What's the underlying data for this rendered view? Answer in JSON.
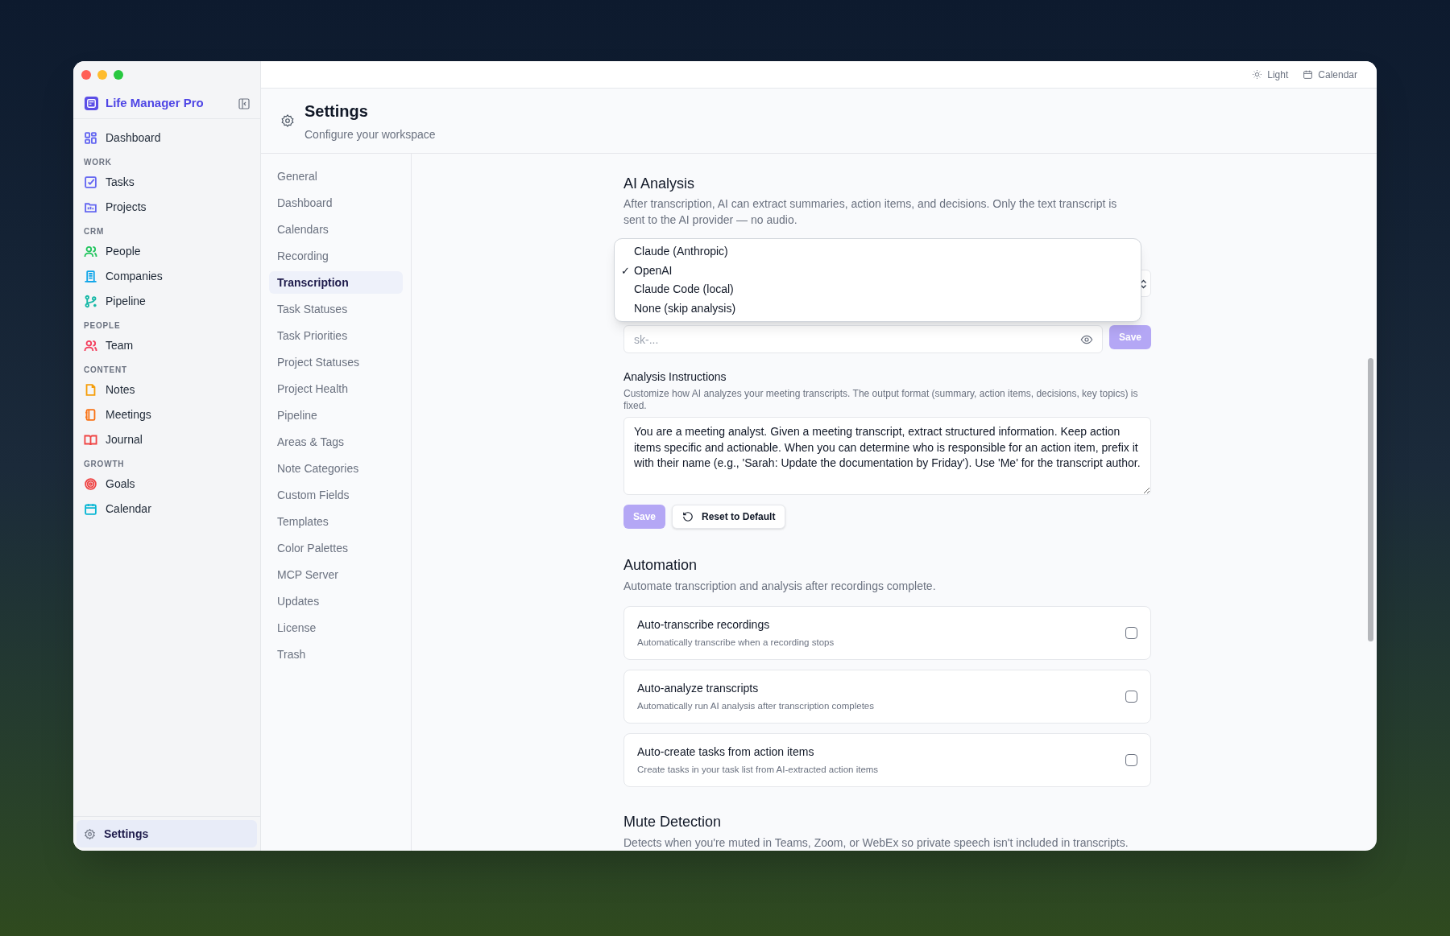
{
  "window": {
    "app_name": "Life Manager Pro"
  },
  "sidebar": {
    "sections": [
      {
        "items": [
          {
            "label": "Dashboard",
            "color": "#6366f1",
            "selected": false
          }
        ]
      },
      {
        "heading": "WORK",
        "items": [
          {
            "label": "Tasks",
            "color": "#6366f1",
            "selected": false
          },
          {
            "label": "Projects",
            "color": "#6366f1",
            "selected": false
          }
        ]
      },
      {
        "heading": "CRM",
        "items": [
          {
            "label": "People",
            "color": "#22c55e",
            "selected": false
          },
          {
            "label": "Companies",
            "color": "#0ea5e9",
            "selected": false
          },
          {
            "label": "Pipeline",
            "color": "#14b8a6",
            "selected": false
          }
        ]
      },
      {
        "heading": "PEOPLE",
        "items": [
          {
            "label": "Team",
            "color": "#f43f5e",
            "selected": false
          }
        ]
      },
      {
        "heading": "CONTENT",
        "items": [
          {
            "label": "Notes",
            "color": "#f59e0b",
            "selected": false
          },
          {
            "label": "Meetings",
            "color": "#f97316",
            "selected": false
          },
          {
            "label": "Journal",
            "color": "#ef4444",
            "selected": false
          }
        ]
      },
      {
        "heading": "GROWTH",
        "items": [
          {
            "label": "Goals",
            "color": "#ef4444",
            "selected": false
          },
          {
            "label": "Calendar",
            "color": "#06b6d4",
            "selected": false
          }
        ]
      }
    ],
    "footer_item": {
      "label": "Settings",
      "selected": true
    }
  },
  "top_bar": {
    "actions": [
      "Light",
      "Calendar"
    ]
  },
  "header": {
    "title": "Settings",
    "subtitle": "Configure your workspace"
  },
  "settings_nav": [
    {
      "label": "General",
      "selected": false
    },
    {
      "label": "Dashboard",
      "selected": false
    },
    {
      "label": "Calendars",
      "selected": false
    },
    {
      "label": "Recording",
      "selected": false
    },
    {
      "label": "Transcription",
      "selected": true
    },
    {
      "label": "Task Statuses",
      "selected": false
    },
    {
      "label": "Task Priorities",
      "selected": false
    },
    {
      "label": "Project Statuses",
      "selected": false
    },
    {
      "label": "Project Health",
      "selected": false
    },
    {
      "label": "Pipeline",
      "selected": false
    },
    {
      "label": "Areas & Tags",
      "selected": false
    },
    {
      "label": "Note Categories",
      "selected": false
    },
    {
      "label": "Custom Fields",
      "selected": false
    },
    {
      "label": "Templates",
      "selected": false
    },
    {
      "label": "Color Palettes",
      "selected": false
    },
    {
      "label": "MCP Server",
      "selected": false
    },
    {
      "label": "Updates",
      "selected": false
    },
    {
      "label": "License",
      "selected": false
    },
    {
      "label": "Trash",
      "selected": false
    }
  ],
  "ai_analysis": {
    "title": "AI Analysis",
    "description": "After transcription, AI can extract summaries, action items, and decisions. Only the text transcript is sent to the AI provider — no audio.",
    "provider_dropdown": {
      "open": true,
      "options": [
        {
          "label": "Claude (Anthropic)",
          "selected": false
        },
        {
          "label": "OpenAI",
          "selected": true
        },
        {
          "label": "Claude Code (local)",
          "selected": false
        },
        {
          "label": "None (skip analysis)",
          "selected": false
        }
      ],
      "check_mark": "✓"
    },
    "api_key": {
      "placeholder": "sk-...",
      "save_button": {
        "label": "Save",
        "disabled": true
      }
    },
    "instructions": {
      "label": "Analysis Instructions",
      "hint": "Customize how AI analyzes your meeting transcripts. The output format (summary, action items, decisions, key topics) is fixed.",
      "value": "You are a meeting analyst. Given a meeting transcript, extract structured information. Keep action items specific and actionable. When you can determine who is responsible for an action item, prefix it with their name (e.g., 'Sarah: Update the documentation by Friday'). Use 'Me' for the transcript author.",
      "save_button": {
        "label": "Save",
        "disabled": true
      },
      "reset_button": "Reset to Default"
    }
  },
  "automation": {
    "title": "Automation",
    "description": "Automate transcription and analysis after recordings complete.",
    "options": [
      {
        "title": "Auto-transcribe recordings",
        "description": "Automatically transcribe when a recording stops",
        "checked": false
      },
      {
        "title": "Auto-analyze transcripts",
        "description": "Automatically run AI analysis after transcription completes",
        "checked": false
      },
      {
        "title": "Auto-create tasks from action items",
        "description": "Create tasks in your task list from AI-extracted action items",
        "checked": false
      }
    ]
  },
  "mute_detection": {
    "title": "Mute Detection",
    "description": "Detects when you're muted in Teams, Zoom, or WebEx so private speech isn't included in transcripts."
  }
}
